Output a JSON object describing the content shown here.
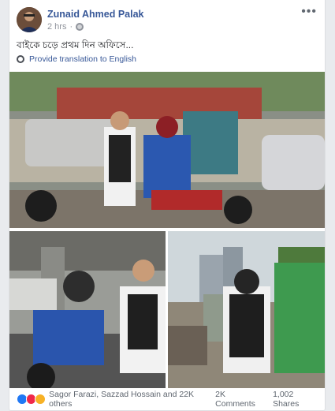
{
  "post": {
    "author": "Zunaid Ahmed Palak",
    "time": "2 hrs",
    "more_label": "•••",
    "text": "বাইকে চড়ে প্রথম দিন অফিসে...",
    "translate_label": "Provide translation to English",
    "reactions": {
      "names": "Sagor Farazi, Sazzad Hossain and 22K others",
      "comments": "2K Comments",
      "shares": "1,002 Shares",
      "icons": [
        "like-icon",
        "love-icon",
        "haha-icon"
      ]
    }
  },
  "colors": {
    "link": "#385898",
    "meta": "#90949c",
    "like": "#2078f4",
    "love": "#f0284a",
    "haha": "#f7b125"
  }
}
